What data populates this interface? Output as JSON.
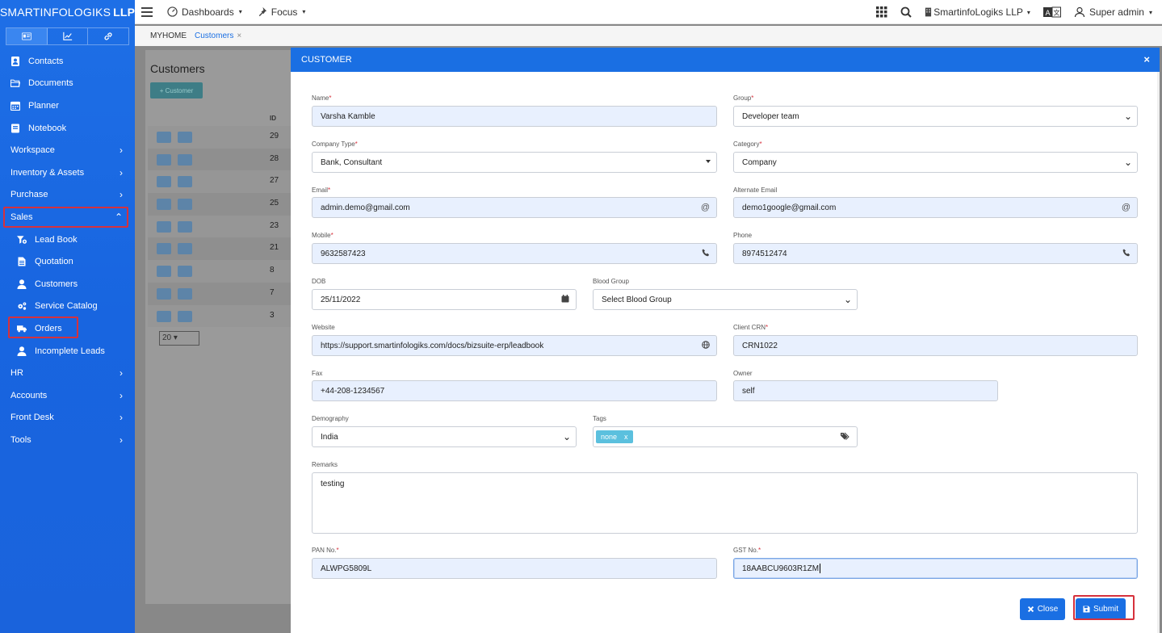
{
  "brand": {
    "name_light": "SMARTINFOLOGIKS",
    "name_bold": "LLP"
  },
  "sidebar": {
    "tabs": [
      {
        "icon": "id-card-icon"
      },
      {
        "icon": "chart-icon"
      },
      {
        "icon": "link-icon"
      }
    ],
    "items": [
      {
        "label": "Contacts",
        "icon": "contact-icon"
      },
      {
        "label": "Documents",
        "icon": "folder-icon"
      },
      {
        "label": "Planner",
        "icon": "calendar-icon"
      },
      {
        "label": "Notebook",
        "icon": "notebook-icon"
      },
      {
        "label": "Workspace",
        "chevron": "›"
      },
      {
        "label": "Inventory & Assets",
        "chevron": "›"
      },
      {
        "label": "Purchase",
        "chevron": "›"
      },
      {
        "label": "Sales",
        "chevron": "⌃",
        "expanded": true
      },
      {
        "label": "Lead Book",
        "icon": "filter-icon",
        "sub": true
      },
      {
        "label": "Quotation",
        "icon": "file-icon",
        "sub": true
      },
      {
        "label": "Customers",
        "icon": "user-icon",
        "sub": true
      },
      {
        "label": "Service Catalog",
        "icon": "cogs-icon",
        "sub": true
      },
      {
        "label": "Orders",
        "icon": "truck-icon",
        "sub": true
      },
      {
        "label": "Incomplete Leads",
        "icon": "user-icon",
        "sub": true
      },
      {
        "label": "HR",
        "chevron": "›"
      },
      {
        "label": "Accounts",
        "chevron": "›"
      },
      {
        "label": "Front Desk",
        "chevron": "›"
      },
      {
        "label": "Tools",
        "chevron": "›"
      }
    ]
  },
  "topbar": {
    "dashboards": "Dashboards",
    "focus": "Focus",
    "company": "SmartinfoLogiks LLP",
    "user": "Super admin"
  },
  "breadcrumb": {
    "home": "MYHOME",
    "current": "Customers",
    "close": "×"
  },
  "background": {
    "title": "Customers",
    "add_button": "+ Customer",
    "id_header": "ID",
    "ids": [
      "29",
      "28",
      "27",
      "25",
      "23",
      "21",
      "8",
      "7",
      "3"
    ],
    "page_size": "20"
  },
  "modal": {
    "title": "CUSTOMER",
    "close_icon": "×",
    "fields": {
      "name": {
        "label": "Name",
        "value": "Varsha Kamble"
      },
      "group": {
        "label": "Group",
        "value": "Developer team"
      },
      "company_type": {
        "label": "Company Type",
        "value": "Bank, Consultant"
      },
      "category": {
        "label": "Category",
        "value": "Company"
      },
      "email": {
        "label": "Email",
        "value": "admin.demo@gmail.com",
        "suffix": "@"
      },
      "alt_email": {
        "label": "Alternate Email",
        "value": "demo1google@gmail.com",
        "suffix": "@"
      },
      "mobile": {
        "label": "Mobile",
        "value": "9632587423"
      },
      "phone": {
        "label": "Phone",
        "value": "8974512474"
      },
      "dob": {
        "label": "DOB",
        "value": "25/11/2022"
      },
      "blood_group": {
        "label": "Blood Group",
        "value": "Select Blood Group"
      },
      "website": {
        "label": "Website",
        "value": "https://support.smartinfologiks.com/docs/bizsuite-erp/leadbook"
      },
      "client_crn": {
        "label": "Client CRN",
        "value": "CRN1022"
      },
      "fax": {
        "label": "Fax",
        "value": "+44-208-1234567"
      },
      "owner": {
        "label": "Owner",
        "value": "self"
      },
      "demography": {
        "label": "Demography",
        "value": "India"
      },
      "tags": {
        "label": "Tags",
        "tag": "none",
        "tag_remove": "x"
      },
      "remarks": {
        "label": "Remarks",
        "value": "testing"
      },
      "pan": {
        "label": "PAN No.",
        "value": "ALWPG5809L"
      },
      "gst": {
        "label": "GST No.",
        "value": "18AABCU9603R1ZM"
      }
    },
    "required_mark": "*",
    "buttons": {
      "close": "Close",
      "submit": "Submit"
    }
  },
  "colors": {
    "primary": "#1a6fe3",
    "highlight": "#d6313c",
    "field_bg": "#e8f0fe",
    "tag": "#5bc0de"
  }
}
